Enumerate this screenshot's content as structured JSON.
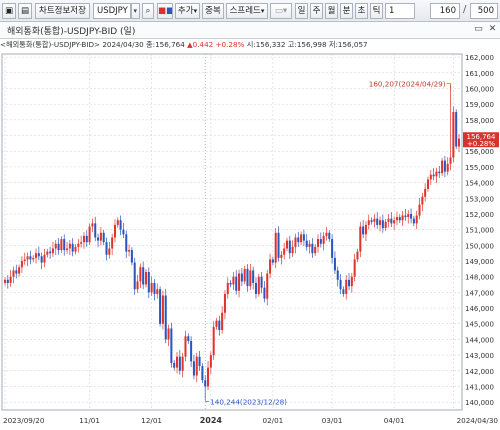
{
  "toolbar": {
    "chart_save_label": "차트정보저장",
    "symbol_value": "USDJPY",
    "add_label": "추가",
    "overlap_label": "중복",
    "spread_label": "스프레드",
    "period_buttons": [
      "일",
      "주",
      "월",
      "분",
      "초",
      "틱"
    ],
    "period_value": "1",
    "count_value": "160",
    "count_separator": "/",
    "count_max": "500"
  },
  "chart_window": {
    "title": "해외통화(통합)-USDJPY-BID (일)",
    "minimize_icon": "minimize-icon",
    "close_icon": "close-icon"
  },
  "info_line": {
    "prefix": "<해외통화(통합)-USDJPY-BID> 2024/04/30",
    "close_label": "종:",
    "close_value": "156,764",
    "change_value": "▲0.442",
    "change_pct": "+0.28%",
    "open_label": "시:",
    "open_value": "156,332",
    "high_label": "고:",
    "high_value": "156,998",
    "low_label": "저:",
    "low_value": "156,057"
  },
  "chart_data": {
    "type": "candlestick",
    "title": "해외통화(통합)-USDJPY-BID (일)",
    "xlabel": "",
    "ylabel": "",
    "ylim": [
      139.5,
      162.2
    ],
    "yticks": [
      "162,000",
      "161,000",
      "160,000",
      "159,000",
      "158,000",
      "157,000",
      "156,000",
      "155,000",
      "154,000",
      "153,000",
      "152,000",
      "151,000",
      "150,000",
      "149,000",
      "148,000",
      "147,000",
      "146,000",
      "145,000",
      "144,000",
      "143,000",
      "142,000",
      "141,000",
      "140,000"
    ],
    "xticks": [
      {
        "label": "2023/09/20",
        "index": 0
      },
      {
        "label": "11/01",
        "index": 30
      },
      {
        "label": "12/01",
        "index": 52
      },
      {
        "label": "2024",
        "index": 73
      },
      {
        "label": "02/01",
        "index": 95
      },
      {
        "label": "03/01",
        "index": 116
      },
      {
        "label": "04/01",
        "index": 138
      },
      {
        "label": "2024/04/30",
        "index": 159
      }
    ],
    "highlight_divider_index": 71,
    "current_price": {
      "value": 156.764,
      "label": "156,764",
      "change": "+0.28%"
    },
    "annotations": [
      {
        "text": "160,207(2024/04/29)",
        "value": 160.207,
        "index": 158,
        "kind": "high"
      },
      {
        "text": "140,244(2023/12/28)",
        "value": 140.244,
        "index": 71,
        "kind": "low"
      }
    ],
    "colors": {
      "up": "#e0332b",
      "down": "#2a55bf",
      "grid": "#c9ced6",
      "divider": "#9aa3b0"
    },
    "closes": [
      147.8,
      147.6,
      148.0,
      148.4,
      148.2,
      148.6,
      149.0,
      149.1,
      149.3,
      149.1,
      149.2,
      149.5,
      149.3,
      148.9,
      149.4,
      149.6,
      149.5,
      149.8,
      150.1,
      149.7,
      150.4,
      149.7,
      149.8,
      150.1,
      149.6,
      149.9,
      150.1,
      150.2,
      150.6,
      150.2,
      151.2,
      151.4,
      150.5,
      150.3,
      150.8,
      150.2,
      149.4,
      149.8,
      150.5,
      151.3,
      151.6,
      151.0,
      150.7,
      149.6,
      149.7,
      148.9,
      147.2,
      147.7,
      148.6,
      147.5,
      148.3,
      147.0,
      147.6,
      146.9,
      147.2,
      145.0,
      146.8,
      144.0,
      144.7,
      142.5,
      142.2,
      142.9,
      142.0,
      142.9,
      144.2,
      143.9,
      142.6,
      141.7,
      142.9,
      142.3,
      141.4,
      141.0,
      142.2,
      143.0,
      144.8,
      145.2,
      144.6,
      145.7,
      146.9,
      147.6,
      147.5,
      148.0,
      147.1,
      148.2,
      147.7,
      148.5,
      147.4,
      148.4,
      147.6,
      146.9,
      148.0,
      147.3,
      146.6,
      148.2,
      149.1,
      148.9,
      150.8,
      149.2,
      149.4,
      149.8,
      150.3,
      149.5,
      149.9,
      150.5,
      150.2,
      150.7,
      150.3,
      149.9,
      150.1,
      149.5,
      149.9,
      150.4,
      150.1,
      150.6,
      150.8,
      150.4,
      149.2,
      148.4,
      147.8,
      147.2,
      146.9,
      147.8,
      147.4,
      148.0,
      149.1,
      149.6,
      151.2,
      150.7,
      151.3,
      151.6,
      151.5,
      151.7,
      151.3,
      151.6,
      151.1,
      151.5,
      151.7,
      151.4,
      151.6,
      151.8,
      151.6,
      151.9,
      151.8,
      152.0,
      151.7,
      151.4,
      151.9,
      152.6,
      153.1,
      153.6,
      154.2,
      154.5,
      154.4,
      154.7,
      154.6,
      155.4,
      154.7,
      155.2,
      155.6,
      158.5,
      156.3,
      156.8
    ],
    "open_close_ranges_note": "",
    "series": []
  }
}
